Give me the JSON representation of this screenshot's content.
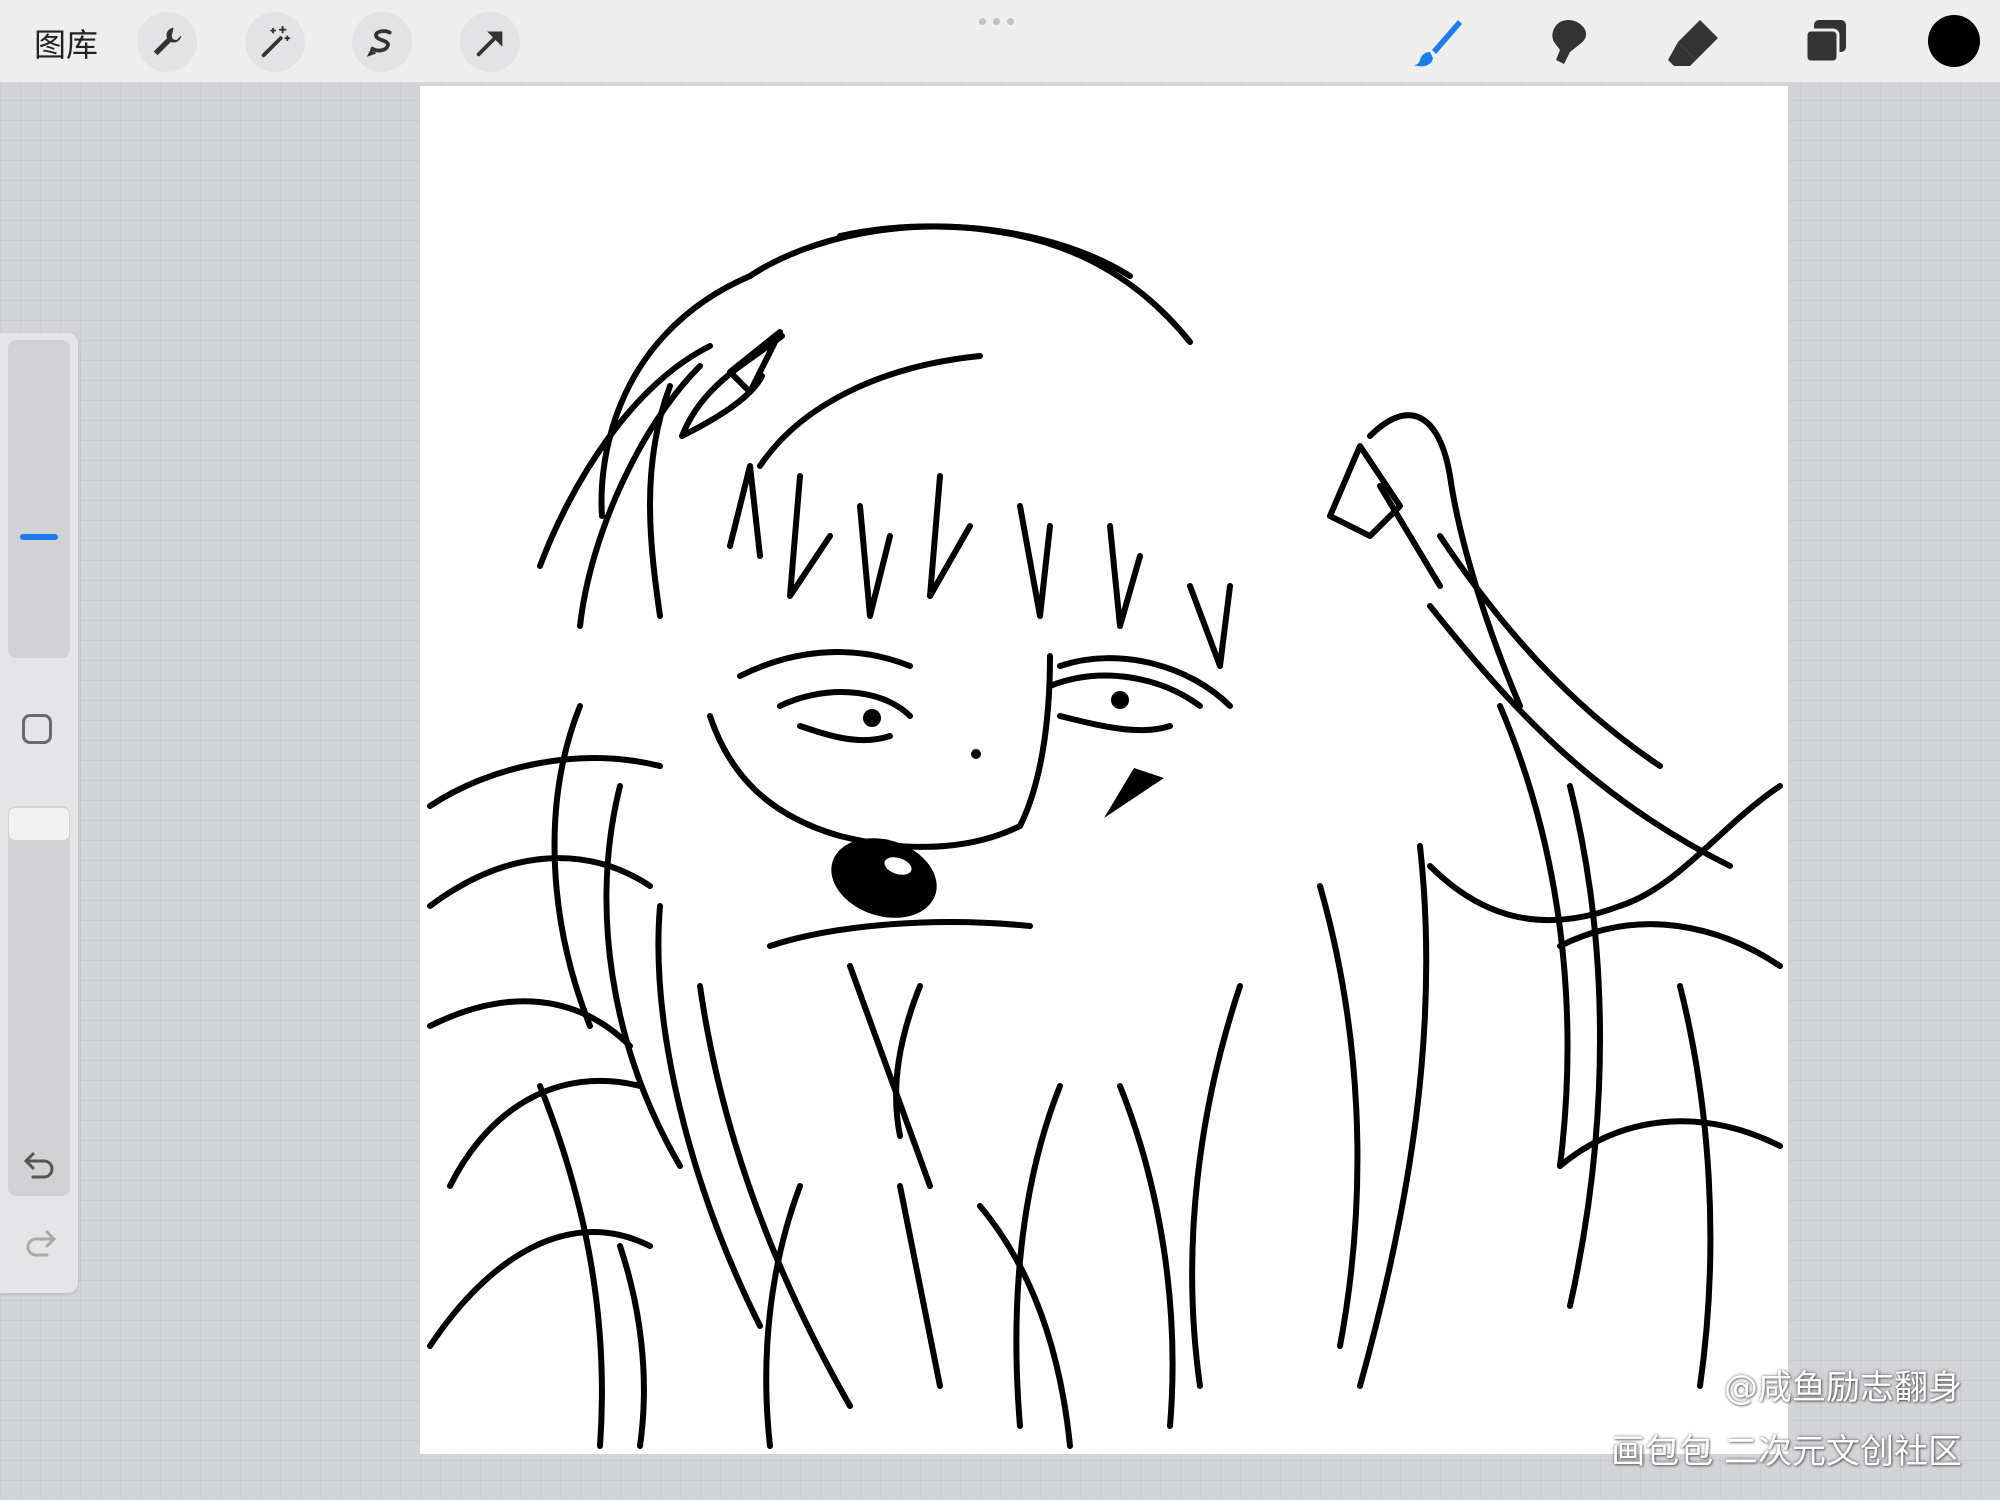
{
  "topbar": {
    "gallery_label": "图库",
    "tools_left": [
      "wrench-icon",
      "magic-wand-icon",
      "selection-icon",
      "transform-arrow-icon"
    ],
    "tools_right": [
      "brush-icon",
      "smudge-icon",
      "eraser-icon",
      "layers-icon"
    ],
    "active_tool": "brush-icon",
    "accent_color": "#1a7cf0",
    "current_color": "#000000"
  },
  "sidebar": {
    "icons": [
      "brush-size-slider",
      "modify-square-icon",
      "opacity-slider",
      "undo-icon",
      "redo-icon"
    ]
  },
  "watermark": {
    "line1": "@咸鱼励志翻身",
    "line2": "画包包 二次元文创社区"
  }
}
